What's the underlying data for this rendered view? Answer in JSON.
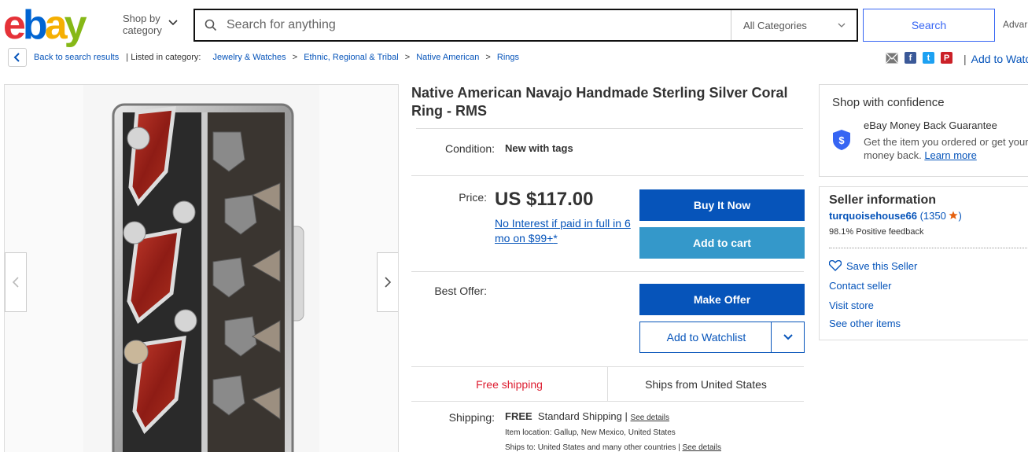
{
  "header": {
    "logo_letters": [
      "e",
      "b",
      "a",
      "y"
    ],
    "shop_by_line1": "Shop by",
    "shop_by_line2": "category",
    "search_placeholder": "Search for anything",
    "category_select": "All Categories",
    "search_button": "Search",
    "advanced": "Advar"
  },
  "breadcrumb": {
    "back": "Back to search results",
    "listed_in": "| Listed in category:",
    "items": [
      "Jewelry & Watches",
      "Ethnic, Regional & Tribal",
      "Native American",
      "Rings"
    ],
    "sep": ">"
  },
  "share": {
    "icons": [
      "mail-icon",
      "facebook-icon",
      "twitter-icon",
      "pinterest-icon"
    ],
    "facebook_glyph": "f",
    "twitter_glyph": "t",
    "pinterest_glyph": "P",
    "divider": "|",
    "add_to_watchlist": "Add to Watc"
  },
  "product": {
    "title": "Native American Navajo Handmade Sterling Silver Coral Ring - RMS",
    "condition_label": "Condition:",
    "condition_value": "New with tags",
    "price_label": "Price:",
    "price": "US $117.00",
    "interest_text": "No Interest if paid in full in 6 mo on $99+",
    "interest_suffix": "*",
    "buy_now": "Buy It Now",
    "add_to_cart": "Add to cart",
    "best_offer_label": "Best Offer:",
    "make_offer": "Make Offer",
    "add_to_watchlist": "Add to Watchlist",
    "free_shipping": "Free shipping",
    "ships_from": "Ships from United States",
    "shipping_label": "Shipping:",
    "shipping_free": "FREE",
    "shipping_method": "Standard Shipping",
    "shipping_sep": "|",
    "see_details": "See details",
    "item_location": "Item location:  Gallup, New Mexico, United States",
    "ships_to": "Ships to:  United States and many other countries",
    "ships_to_sep": "|",
    "see_details_2": "See details"
  },
  "confidence": {
    "heading": "Shop with confidence",
    "guarantee_title": "eBay Money Back Guarantee",
    "guarantee_desc": "Get the item you ordered or get your money back.",
    "learn_more": "Learn more",
    "shield_glyph": "$"
  },
  "seller": {
    "heading": "Seller information",
    "name": "turquoisehouse66",
    "score_open": "(1350",
    "score_close": ")",
    "feedback": "98.1% Positive feedback",
    "save_seller": "Save this Seller",
    "contact": "Contact seller",
    "visit_store": "Visit store",
    "other_items": "See other items"
  },
  "colors": {
    "primary_blue": "#0654ba",
    "cart_blue": "#3498ca",
    "free_shipping_red": "#dd1e31",
    "star_orange": "#e5600e"
  }
}
